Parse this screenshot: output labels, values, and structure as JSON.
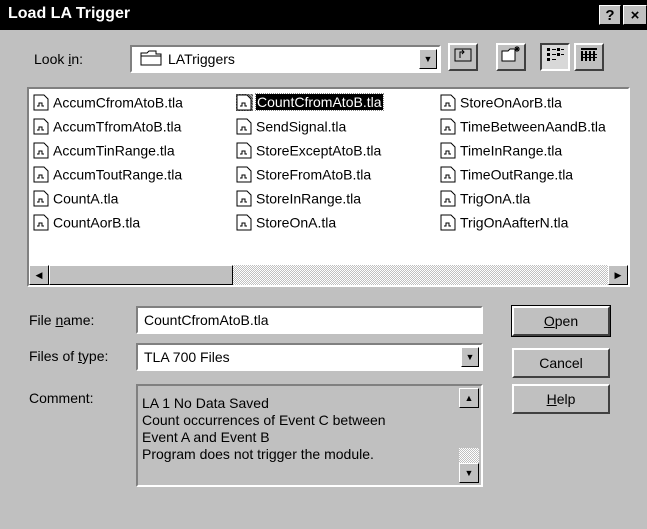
{
  "window": {
    "title": "Load LA Trigger",
    "help_glyph": "?",
    "close_glyph": "×"
  },
  "look_in": {
    "label_pre": "Look ",
    "label_key": "i",
    "label_post": "n:",
    "value": "LATriggers"
  },
  "toolbar": {
    "up_folder_icon": "up-folder-icon",
    "new_folder_icon": "new-folder-icon",
    "list_view_icon": "list-view-icon",
    "details_view_icon": "details-view-icon"
  },
  "files": {
    "col1": [
      "AccumCfromAtoB.tla",
      "AccumTfromAtoB.tla",
      "AccumTinRange.tla",
      "AccumToutRange.tla",
      "CountA.tla",
      "CountAorB.tla"
    ],
    "col2": [
      "CountCfromAtoB.tla",
      "SendSignal.tla",
      "StoreExceptAtoB.tla",
      "StoreFromAtoB.tla",
      "StoreInRange.tla",
      "StoreOnA.tla"
    ],
    "col3": [
      "StoreOnAorB.tla",
      "TimeBetweenAandB.tla",
      "TimeInRange.tla",
      "TimeOutRange.tla",
      "TrigOnA.tla",
      "TrigOnAafterN.tla"
    ],
    "selected": "CountCfromAtoB.tla"
  },
  "file_name": {
    "label_pre": "File ",
    "label_key": "n",
    "label_post": "ame:",
    "value": "CountCfromAtoB.tla"
  },
  "files_of_type": {
    "label_pre": "Files of ",
    "label_key": "t",
    "label_post": "ype:",
    "value": "TLA 700 Files"
  },
  "comment": {
    "label": "Comment:",
    "lines": [
      "LA 1   No Data Saved",
      "Count occurrences of Event C between",
      "Event A and Event B",
      "Program does not trigger the module."
    ]
  },
  "buttons": {
    "open_key": "O",
    "open_rest": "pen",
    "cancel": "Cancel",
    "help_key": "H",
    "help_rest": "elp"
  },
  "colors": {
    "titlebar": "#000000",
    "face": "#c0c0c0",
    "selection": "#000000"
  }
}
